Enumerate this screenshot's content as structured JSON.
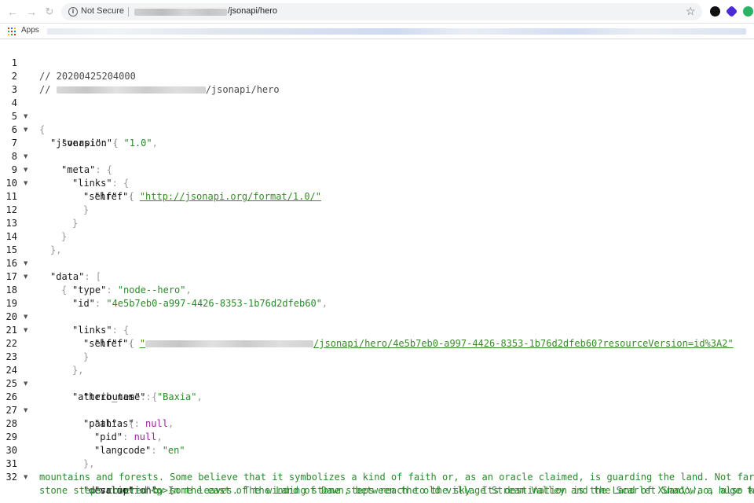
{
  "browser": {
    "security_label": "Not Secure",
    "url_path": "/jsonapi/hero",
    "bookmarks_label": "Apps"
  },
  "colors": {
    "key": "#1a1a1a",
    "string": "#2a8a2a",
    "null": "#a020a0",
    "punctuation": "#9a9a9a"
  },
  "source": {
    "comment_timestamp": "// 20200425204000",
    "comment_url_prefix": "// ",
    "comment_url_path": "/jsonapi/hero",
    "jsonapi_key": "\"jsonapi\"",
    "version_key": "\"version\"",
    "version_value": "\"1.0\"",
    "meta_key": "\"meta\"",
    "links_key": "\"links\"",
    "self_key": "\"self\"",
    "href_key": "\"href\"",
    "meta_href_value": "\"http://jsonapi.org/format/1.0/\"",
    "data_key": "\"data\"",
    "type_key": "\"type\"",
    "type_value": "\"node--hero\"",
    "id_key": "\"id\"",
    "id_value": "\"4e5b7eb0-a997-4426-8353-1b76d2dfeb60\"",
    "item_href_value_start": "\"",
    "item_href_value_path": "/jsonapi/hero/4e5b7eb0-a997-4426-8353-1b76d2dfeb60?resourceVersion=id%3A2\"",
    "attributes_key": "\"attributes\"",
    "hero_name_key": "\"hero_name\"",
    "hero_name_value": "\"Baxia\"",
    "path_key": "\"path\"",
    "alias_key": "\"alias\"",
    "pid_key": "\"pid\"",
    "null_value": "null",
    "langcode_key": "\"langcode\"",
    "langcode_value": "\"en\"",
    "description_key": "\"description\"",
    "value_key": "\"value\"",
    "value_line_1": "\"<p>In the east of the Land of Dawn, between the old village Stream Valley and the Scarlet Shadow, a huge totem r",
    "value_line_2": "mountains and forests. Some believe that it symbolizes a kind of faith or, as an oracle claimed, is guarding the land. Not far from",
    "value_line_3": "stone steps covered by some leaves. The winding stone steps reach to the sky. Its destination is the Land of Xuan\\\\'ao, also known a"
  }
}
